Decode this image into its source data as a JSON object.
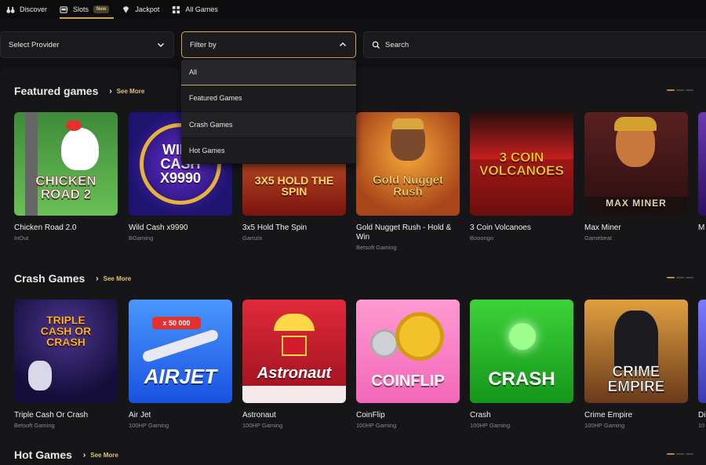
{
  "nav": {
    "items": [
      {
        "label": "Discover",
        "icon": "binoculars-icon"
      },
      {
        "label": "Slots",
        "icon": "slot-machine-icon",
        "badge": "New",
        "active": true
      },
      {
        "label": "Jackpot",
        "icon": "diamond-icon"
      },
      {
        "label": "All Games",
        "icon": "grid-icon"
      }
    ]
  },
  "filters": {
    "provider_label": "Select Provider",
    "filter_label": "Filter by",
    "search_label": "Search"
  },
  "dropdown": {
    "options": [
      "All",
      "Featured Games",
      "Crash Games",
      "Hot Games"
    ],
    "selected": "All"
  },
  "sections": [
    {
      "title": "Featured games",
      "see_more": "See More",
      "games": [
        {
          "name": "Chicken Road 2.0",
          "provider": "InOut",
          "art": "CHICKEN ROAD 2"
        },
        {
          "name": "Wild Cash x9990",
          "provider": "BGaming",
          "art": "WILD CASH X9990"
        },
        {
          "name": "3x5 Hold The Spin",
          "provider": "Gamzix",
          "art": "3X5 HOLD THE SPIN"
        },
        {
          "name": "Gold Nugget Rush - Hold & Win",
          "provider": "Betsoft Gaming",
          "art": "Gold Nugget Rush"
        },
        {
          "name": "3 Coin Volcanoes",
          "provider": "Booongo",
          "art": "3 COIN VOLCANOES"
        },
        {
          "name": "Max Miner",
          "provider": "Gamebeat",
          "art": "MAX MINER"
        },
        {
          "name": "M",
          "provider": "",
          "art": ""
        }
      ]
    },
    {
      "title": "Crash Games",
      "see_more": "See More",
      "games": [
        {
          "name": "Triple Cash Or Crash",
          "provider": "Betsoft Gaming",
          "art": "TRIPLE CASH OR CRASH"
        },
        {
          "name": "Air Jet",
          "provider": "100HP Gaming",
          "art": "AIRJET"
        },
        {
          "name": "Astronaut",
          "provider": "100HP Gaming",
          "art": "Astronaut"
        },
        {
          "name": "CoinFlip",
          "provider": "100HP Gaming",
          "art": "COINFLIP"
        },
        {
          "name": "Crash",
          "provider": "100HP Gaming",
          "art": "CRASH"
        },
        {
          "name": "Crime Empire",
          "provider": "100HP Gaming",
          "art": "CRIME EMPIRE"
        },
        {
          "name": "Di",
          "provider": "10",
          "art": ""
        }
      ]
    },
    {
      "title": "Hot Games",
      "see_more": "See More",
      "games": []
    }
  ],
  "colors": {
    "accent": "#d4a64a",
    "background": "#111114",
    "panel": "#161619"
  }
}
